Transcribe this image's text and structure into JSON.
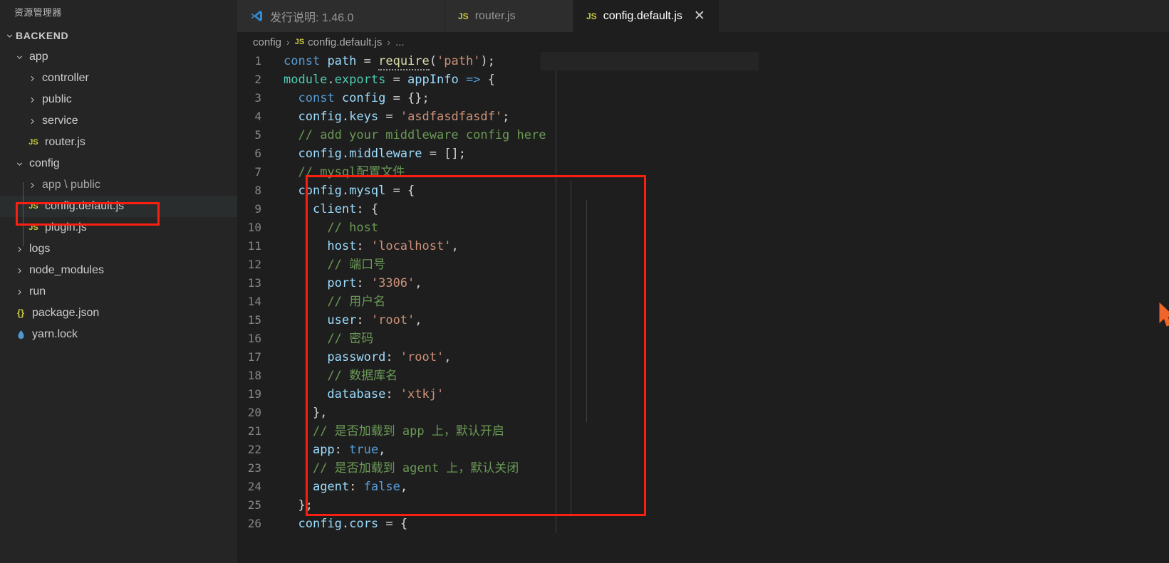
{
  "sidebar": {
    "title": "资源管理器",
    "section_label": "BACKEND",
    "items": [
      {
        "label": "app",
        "icon": "chevron-down-icon",
        "depth": 1
      },
      {
        "label": "controller",
        "icon": "chevron-right-icon",
        "depth": 2
      },
      {
        "label": "public",
        "icon": "chevron-right-icon",
        "depth": 2
      },
      {
        "label": "service",
        "icon": "chevron-right-icon",
        "depth": 2
      },
      {
        "label": "router.js",
        "icon": "js-file-icon",
        "depth": 2
      },
      {
        "label": "config",
        "icon": "chevron-down-icon",
        "depth": 1
      },
      {
        "label": "app \\ public",
        "icon": "chevron-right-icon",
        "depth": 2
      },
      {
        "label": "config.default.js",
        "icon": "js-file-icon",
        "depth": 2
      },
      {
        "label": "plugin.js",
        "icon": "js-file-icon",
        "depth": 2
      },
      {
        "label": "logs",
        "icon": "chevron-right-icon",
        "depth": 1
      },
      {
        "label": "node_modules",
        "icon": "chevron-right-icon",
        "depth": 1
      },
      {
        "label": "run",
        "icon": "chevron-right-icon",
        "depth": 1
      },
      {
        "label": "package.json",
        "icon": "json-file-icon",
        "depth": 1
      },
      {
        "label": "yarn.lock",
        "icon": "lock-file-icon",
        "depth": 1
      }
    ],
    "selected_item": "config.default.js"
  },
  "tabs": [
    {
      "label": "发行说明: 1.46.0",
      "icon": "vscode-logo-icon",
      "active": false,
      "closable": false
    },
    {
      "label": "router.js",
      "icon": "js-file-icon",
      "active": false,
      "closable": false
    },
    {
      "label": "config.default.js",
      "icon": "js-file-icon",
      "active": true,
      "closable": true,
      "close_glyph": "✕"
    }
  ],
  "breadcrumb": {
    "folder": "config",
    "file": "config.default.js",
    "ellipsis": "...",
    "separator": "›"
  },
  "editor": {
    "first_line": 1,
    "last_line": 26,
    "lines": [
      {
        "n": "1",
        "tokens": [
          {
            "t": "const",
            "c": "tk-kw"
          },
          {
            "t": " ",
            "c": "tk-op"
          },
          {
            "t": "path",
            "c": "tk-var"
          },
          {
            "t": " = ",
            "c": "tk-op"
          },
          {
            "t": "require",
            "c": "tk-fn",
            "u": true
          },
          {
            "t": "(",
            "c": "tk-op"
          },
          {
            "t": "'path'",
            "c": "tk-str"
          },
          {
            "t": ");",
            "c": "tk-op"
          }
        ]
      },
      {
        "n": "2",
        "tokens": [
          {
            "t": "module",
            "c": "tk-grn"
          },
          {
            "t": ".",
            "c": "tk-op"
          },
          {
            "t": "exports",
            "c": "tk-grn"
          },
          {
            "t": " = ",
            "c": "tk-op"
          },
          {
            "t": "appInfo",
            "c": "tk-var"
          },
          {
            "t": " ",
            "c": "tk-op"
          },
          {
            "t": "=>",
            "c": "tk-kw"
          },
          {
            "t": " {",
            "c": "tk-op"
          }
        ]
      },
      {
        "n": "3",
        "tokens": [
          {
            "t": "  ",
            "c": "tk-op"
          },
          {
            "t": "const",
            "c": "tk-kw"
          },
          {
            "t": " ",
            "c": "tk-op"
          },
          {
            "t": "config",
            "c": "tk-var"
          },
          {
            "t": " = {};",
            "c": "tk-op"
          }
        ]
      },
      {
        "n": "4",
        "tokens": [
          {
            "t": "  ",
            "c": "tk-op"
          },
          {
            "t": "config",
            "c": "tk-var"
          },
          {
            "t": ".",
            "c": "tk-op"
          },
          {
            "t": "keys",
            "c": "tk-var"
          },
          {
            "t": " = ",
            "c": "tk-op"
          },
          {
            "t": "'asdfasdfasdf'",
            "c": "tk-str"
          },
          {
            "t": ";",
            "c": "tk-op"
          }
        ]
      },
      {
        "n": "5",
        "tokens": [
          {
            "t": "  ",
            "c": "tk-op"
          },
          {
            "t": "// add your middleware config here",
            "c": "tk-cmt"
          }
        ]
      },
      {
        "n": "6",
        "tokens": [
          {
            "t": "  ",
            "c": "tk-op"
          },
          {
            "t": "config",
            "c": "tk-var"
          },
          {
            "t": ".",
            "c": "tk-op"
          },
          {
            "t": "middleware",
            "c": "tk-var"
          },
          {
            "t": " = [];",
            "c": "tk-op"
          }
        ]
      },
      {
        "n": "7",
        "tokens": [
          {
            "t": "  ",
            "c": "tk-op"
          },
          {
            "t": "// mysql配置文件",
            "c": "tk-cmt"
          }
        ]
      },
      {
        "n": "8",
        "tokens": [
          {
            "t": "  ",
            "c": "tk-op"
          },
          {
            "t": "config",
            "c": "tk-var"
          },
          {
            "t": ".",
            "c": "tk-op"
          },
          {
            "t": "mysql",
            "c": "tk-var"
          },
          {
            "t": " = {",
            "c": "tk-op"
          }
        ]
      },
      {
        "n": "9",
        "tokens": [
          {
            "t": "    ",
            "c": "tk-op"
          },
          {
            "t": "client",
            "c": "tk-var"
          },
          {
            "t": ": {",
            "c": "tk-op"
          }
        ]
      },
      {
        "n": "10",
        "tokens": [
          {
            "t": "      ",
            "c": "tk-op"
          },
          {
            "t": "// host",
            "c": "tk-cmt"
          }
        ]
      },
      {
        "n": "11",
        "tokens": [
          {
            "t": "      ",
            "c": "tk-op"
          },
          {
            "t": "host",
            "c": "tk-var"
          },
          {
            "t": ": ",
            "c": "tk-op"
          },
          {
            "t": "'localhost'",
            "c": "tk-str"
          },
          {
            "t": ",",
            "c": "tk-op"
          }
        ]
      },
      {
        "n": "12",
        "tokens": [
          {
            "t": "      ",
            "c": "tk-op"
          },
          {
            "t": "// 端口号",
            "c": "tk-cmt"
          }
        ]
      },
      {
        "n": "13",
        "tokens": [
          {
            "t": "      ",
            "c": "tk-op"
          },
          {
            "t": "port",
            "c": "tk-var"
          },
          {
            "t": ": ",
            "c": "tk-op"
          },
          {
            "t": "'3306'",
            "c": "tk-str"
          },
          {
            "t": ",",
            "c": "tk-op"
          }
        ]
      },
      {
        "n": "14",
        "tokens": [
          {
            "t": "      ",
            "c": "tk-op"
          },
          {
            "t": "// 用户名",
            "c": "tk-cmt"
          }
        ]
      },
      {
        "n": "15",
        "tokens": [
          {
            "t": "      ",
            "c": "tk-op"
          },
          {
            "t": "user",
            "c": "tk-var"
          },
          {
            "t": ": ",
            "c": "tk-op"
          },
          {
            "t": "'root'",
            "c": "tk-str"
          },
          {
            "t": ",",
            "c": "tk-op"
          }
        ]
      },
      {
        "n": "16",
        "tokens": [
          {
            "t": "      ",
            "c": "tk-op"
          },
          {
            "t": "// 密码",
            "c": "tk-cmt"
          }
        ]
      },
      {
        "n": "17",
        "tokens": [
          {
            "t": "      ",
            "c": "tk-op"
          },
          {
            "t": "password",
            "c": "tk-var"
          },
          {
            "t": ": ",
            "c": "tk-op"
          },
          {
            "t": "'root'",
            "c": "tk-str"
          },
          {
            "t": ",",
            "c": "tk-op"
          }
        ]
      },
      {
        "n": "18",
        "tokens": [
          {
            "t": "      ",
            "c": "tk-op"
          },
          {
            "t": "// 数据库名",
            "c": "tk-cmt"
          }
        ]
      },
      {
        "n": "19",
        "tokens": [
          {
            "t": "      ",
            "c": "tk-op"
          },
          {
            "t": "database",
            "c": "tk-var"
          },
          {
            "t": ": ",
            "c": "tk-op"
          },
          {
            "t": "'xtkj'",
            "c": "tk-str"
          }
        ]
      },
      {
        "n": "20",
        "tokens": [
          {
            "t": "    },",
            "c": "tk-op"
          }
        ]
      },
      {
        "n": "21",
        "tokens": [
          {
            "t": "    ",
            "c": "tk-op"
          },
          {
            "t": "// 是否加载到 app 上，默认开启",
            "c": "tk-cmt"
          }
        ]
      },
      {
        "n": "22",
        "tokens": [
          {
            "t": "    ",
            "c": "tk-op"
          },
          {
            "t": "app",
            "c": "tk-var"
          },
          {
            "t": ": ",
            "c": "tk-op"
          },
          {
            "t": "true",
            "c": "tk-kw"
          },
          {
            "t": ",",
            "c": "tk-op"
          }
        ]
      },
      {
        "n": "23",
        "tokens": [
          {
            "t": "    ",
            "c": "tk-op"
          },
          {
            "t": "// 是否加载到 agent 上，默认关闭",
            "c": "tk-cmt"
          }
        ]
      },
      {
        "n": "24",
        "tokens": [
          {
            "t": "    ",
            "c": "tk-op"
          },
          {
            "t": "agent",
            "c": "tk-var"
          },
          {
            "t": ": ",
            "c": "tk-op"
          },
          {
            "t": "false",
            "c": "tk-kw"
          },
          {
            "t": ",",
            "c": "tk-op"
          }
        ]
      },
      {
        "n": "25",
        "tokens": [
          {
            "t": "  };",
            "c": "tk-op"
          }
        ]
      },
      {
        "n": "26",
        "tokens": [
          {
            "t": "  ",
            "c": "tk-op"
          },
          {
            "t": "config",
            "c": "tk-var"
          },
          {
            "t": ".",
            "c": "tk-op"
          },
          {
            "t": "cors",
            "c": "tk-var"
          },
          {
            "t": " = {",
            "c": "tk-op"
          }
        ]
      }
    ]
  },
  "annotations": {
    "sidebar_box": {
      "label": "red-highlight-sidebar-file"
    },
    "code_box": {
      "label": "red-highlight-mysql-config-block"
    }
  },
  "colors": {
    "annotation_red": "#fb1f12",
    "editor_bg": "#1e1e1e",
    "sidebar_bg": "#252526",
    "accent_js": "#cbcb41",
    "cursor_orange": "#f06529"
  }
}
